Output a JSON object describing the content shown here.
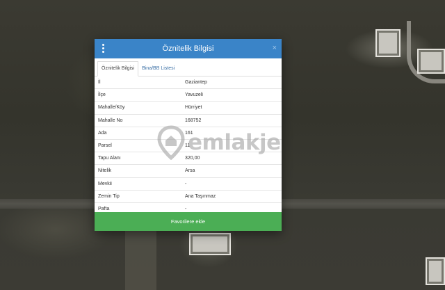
{
  "dialog": {
    "title": "Öznitelik Bilgisi",
    "close_symbol": "×",
    "tabs": [
      {
        "label": "Öznitelik Bilgisi",
        "active": true
      },
      {
        "label": "Bina/BB Listesi",
        "active": false
      }
    ],
    "rows": [
      {
        "label": "İl",
        "value": "Gaziantep"
      },
      {
        "label": "İlçe",
        "value": "Yavuzeli"
      },
      {
        "label": "Mahalle/Köy",
        "value": "Hürriyet"
      },
      {
        "label": "Mahalle No",
        "value": "168752"
      },
      {
        "label": "Ada",
        "value": "161"
      },
      {
        "label": "Parsel",
        "value": "11"
      },
      {
        "label": "Tapu Alanı",
        "value": "320,00"
      },
      {
        "label": "Nitelik",
        "value": "Arsa"
      },
      {
        "label": "Mevkii",
        "value": "-"
      },
      {
        "label": "Zemin Tip",
        "value": "Ana Taşınmaz"
      },
      {
        "label": "Pafta",
        "value": "-"
      }
    ],
    "favorite_button": "Favorilere ekle"
  },
  "watermark": {
    "text": "emlakje",
    "icon": "location-pin-icon"
  },
  "colors": {
    "header": "#3a84c8",
    "button": "#4bae55",
    "tab_link": "#3a6fa5"
  }
}
